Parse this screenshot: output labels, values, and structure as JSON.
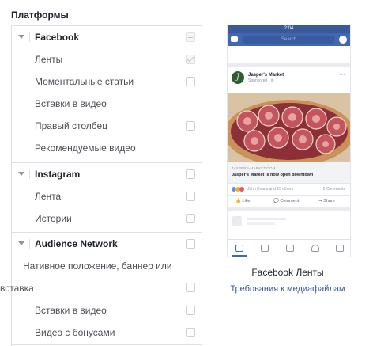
{
  "section": {
    "title": "Платформы"
  },
  "platforms": {
    "facebook": {
      "label": "Facebook",
      "state": "partial"
    },
    "facebook_items": [
      {
        "label": "Ленты",
        "state": "checked-disabled"
      },
      {
        "label": "Моментальные статьи",
        "state": "unchecked"
      },
      {
        "label": "Вставки в видео",
        "state": "none"
      },
      {
        "label": "Правый столбец",
        "state": "unchecked"
      },
      {
        "label": "Рекомендуемые видео",
        "state": "none"
      }
    ],
    "instagram": {
      "label": "Instagram",
      "state": "unchecked"
    },
    "instagram_items": [
      {
        "label": "Лента",
        "state": "unchecked"
      },
      {
        "label": "Истории",
        "state": "unchecked"
      }
    ],
    "audience_network": {
      "label": "Audience Network",
      "state": "unchecked"
    },
    "audience_items": [
      {
        "label_line1": "Нативное положение, баннер или",
        "label_line2": "вставка",
        "state": "unchecked"
      },
      {
        "label": "Вставки в видео",
        "state": "unchecked"
      },
      {
        "label": "Видео с бонусами",
        "state": "unchecked"
      }
    ]
  },
  "preview": {
    "status_time": "2:04",
    "search_placeholder": "Search",
    "advertiser": "Jasper's Market",
    "sponsored": "Sponsored · ⚙",
    "link_url": "JASPERS-MARKET.COM",
    "link_headline": "Jasper's Market is now open downtown",
    "reactions_text": "John Evans and 23 others",
    "comments_text": "2 Comments",
    "action_like": "Like",
    "action_comment": "Comment",
    "action_share": "Share",
    "placement_name": "Facebook Ленты",
    "media_requirements_link": "Требования к медиафайлам",
    "colors": {
      "fb_blue": "#4267b2",
      "statusbar": "#3b5998",
      "link": "#365899"
    }
  }
}
